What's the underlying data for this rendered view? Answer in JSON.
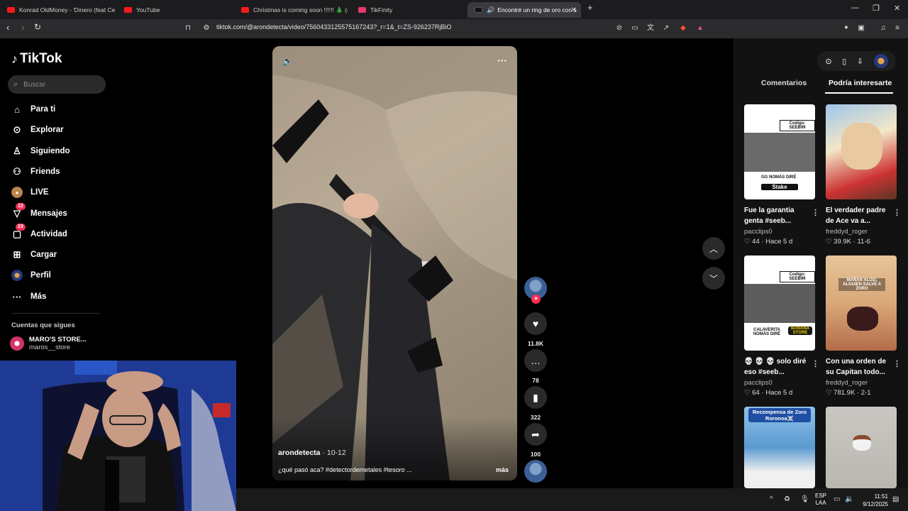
{
  "browser": {
    "tabs": [
      {
        "title": "Konrad OldMoney - 'Dinero (feat Ce",
        "favicon": "youtube-icon"
      },
      {
        "title": "YouTube",
        "favicon": "youtube-icon"
      },
      {
        "title": "Christmas is coming soon !!!!!! 🎄 (sp",
        "favicon": "youtube-icon"
      },
      {
        "title": "TikFinity",
        "favicon": "tikfinity-icon"
      },
      {
        "title": "Encontré un ring de oro con s",
        "favicon": "tiktok-icon",
        "active": true
      }
    ],
    "new_tab": "+",
    "url": "tiktok.com/@arondetecta/video/7560433125575167243?_r=1&_t=ZS-926237RjBiO"
  },
  "sidebar": {
    "brand": "TikTok",
    "search_placeholder": "Buscar",
    "items": [
      {
        "label": "Para ti",
        "icon": "home-icon"
      },
      {
        "label": "Explorar",
        "icon": "compass-icon"
      },
      {
        "label": "Siguiendo",
        "icon": "following-icon"
      },
      {
        "label": "Friends",
        "icon": "friends-icon"
      },
      {
        "label": "LIVE",
        "icon": "live-icon"
      },
      {
        "label": "Mensajes",
        "icon": "messages-icon",
        "badge": "12"
      },
      {
        "label": "Actividad",
        "icon": "activity-icon",
        "badge": "23"
      },
      {
        "label": "Cargar",
        "icon": "upload-icon"
      },
      {
        "label": "Perfil",
        "icon": "profile-icon"
      },
      {
        "label": "Más",
        "icon": "more-icon"
      }
    ],
    "following_title": "Cuentas que sigues",
    "following": [
      {
        "name": "MARO'S STORE...",
        "handle": "maros__store"
      }
    ]
  },
  "video": {
    "author": "arondetecta",
    "date": " · 10-12",
    "caption": "¿qué pasó aca? #detectordemetales #tesoro ...",
    "more": "más"
  },
  "actions": {
    "likes": "11.8K",
    "comments": "78",
    "saves": "322",
    "shares": "100"
  },
  "right_panel": {
    "tabs": [
      "Comentarios",
      "Podría interesarte"
    ],
    "cards": [
      {
        "title": "Fue la garantia genta #seeb...",
        "author": "pacclips0",
        "likes": "44",
        "time": "Hace 5 d",
        "overlay": [
          "Codigo: SEEB99",
          "GG NOMÁS DIRÉ",
          "Stake"
        ]
      },
      {
        "title": "El verdader padre de Ace va a...",
        "author": "freddyd_roger",
        "likes": "39.9K",
        "time": "11-6",
        "overlay": []
      },
      {
        "title": "💀 💀 💀 solo diré eso #seeb...",
        "author": "pacclips0",
        "likes": "64",
        "time": "Hace 5 d",
        "overlay": [
          "Codigo: SEEB99",
          "CALAVERITA NOMÁS DIRÉ",
          "BANANA STORE"
        ]
      },
      {
        "title": "Con una orden de su Capitan todo...",
        "author": "freddyd_roger",
        "likes": "781.9K",
        "time": "2-1",
        "overlay": [
          "MAÑAN ALGO, ALGUIEN SALVE A ZORO"
        ]
      },
      {
        "title": "",
        "author": "",
        "likes": "",
        "time": "",
        "overlay": [
          "Recompensa de Zoro Roronoa☠️"
        ]
      },
      {
        "title": "",
        "author": "",
        "likes": "",
        "time": "",
        "overlay": []
      }
    ]
  },
  "taskbar": {
    "lang_line1": "ESP",
    "lang_line2": "LAA",
    "time": "11:51",
    "date": "9/12/2025"
  },
  "colors": {
    "accent": "#fe2c55",
    "background": "#000000",
    "panel": "#121212"
  }
}
